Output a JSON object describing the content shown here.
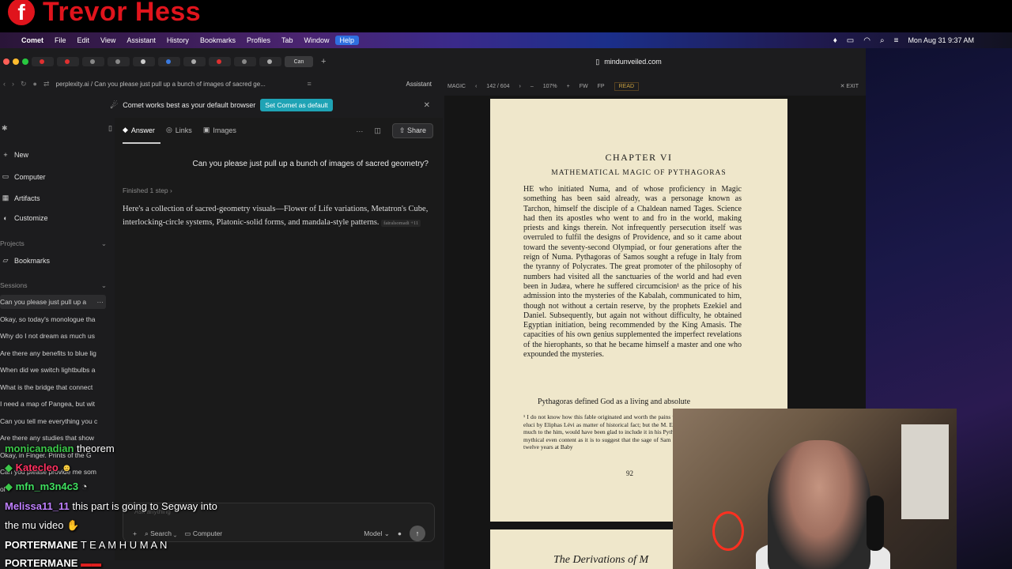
{
  "overlay": {
    "streamer_name": "Trevor Hess",
    "fb_glyph": "f"
  },
  "menubar": {
    "apple": "",
    "items": [
      "Comet",
      "File",
      "Edit",
      "View",
      "Assistant",
      "History",
      "Bookmarks",
      "Profiles",
      "Tab",
      "Window",
      "Help"
    ],
    "clock": "Mon Aug 31  9:37 AM"
  },
  "tabs": {
    "active_label": "Can",
    "plus": "+"
  },
  "urlbar": {
    "url": "perplexity.ai / Can you please just pull up a bunch of images of sacred ge...",
    "assistant": "Assistant"
  },
  "banner": {
    "message": "Comet works best as your default browser",
    "button": "Set Comet as default",
    "close": "✕"
  },
  "sidebar": {
    "new": "New",
    "computer": "Computer",
    "artifacts": "Artifacts",
    "customize": "Customize",
    "projects_label": "Projects",
    "bookmarks": "Bookmarks",
    "sessions_label": "Sessions",
    "sessions": [
      "Can you please just pull up a",
      "Okay, so today's monologue tha",
      "Why do I not dream as much us",
      "Are there any benefits to blue lig",
      "When did we switch lightbulbs a",
      "What is the bridge that connect",
      "I need a map of Pangea, but wit",
      "Can you tell me everything you c",
      "Are there any studies that show",
      "Okay, in Finger. Prints of the G",
      "Can you please provide me som",
      "ol"
    ]
  },
  "chat": {
    "tabs": [
      "Answer",
      "Links",
      "Images"
    ],
    "share": "Share",
    "query": "Can you please just pull up a bunch of images of sacred geometry?",
    "finished": "Finished 1 step  ›",
    "answer": "Here's a collection of sacred-geometry visuals—Flower of Life variations, Metatron's Cube, interlocking-circle systems, Platonic-solid forms, and mandala-style patterns.",
    "citation": "fairalsomadi +11",
    "input_placeholder": "Ask anything",
    "search": "Search",
    "computer": "Computer",
    "model": "Model",
    "send": "↑"
  },
  "reader": {
    "domain": "mindunveiled.com",
    "toolbar": [
      "MAGIC",
      "‹",
      "142 / 604",
      "›",
      "–",
      "107%",
      "+",
      "FW",
      "FP",
      "READ",
      "✕ EXIT"
    ],
    "chapter": "CHAPTER VI",
    "title": "MATHEMATICAL MAGIC OF PYTHAGORAS",
    "body": "HE who initiated Numa, and of whose proficiency in Magic something has been said already, was a personage known as Tarchon, himself the disciple of a Chaldean named Tages. Science had then its apostles who went to and fro in the world, making priests and kings therein. Not infrequently persecution itself was overruled to fulfil the designs of Providence, and so it came about toward the seventy-second Olympiad, or four generations after the reign of Numa. Pythagoras of Samos sought a refuge in Italy from the tyranny of Polycrates. The great promoter of the philosophy of numbers had visited all the sanctuaries of the world and had even been in Judæa, where he suffered circumcision¹ as the price of his admission into the mysteries of the Kabalah, communicated to him, though not without a certain reserve, by the prophets Ezekiel and Daniel. Subsequently, but again not without difficulty, he obtained Egyptian initiation, being recommended by the King Amasis. The capacities of his own genius supplemented the imperfect revelations of the hierophants, so that he became himself a master and one who expounded the mysteries.",
    "body2": "Pythagoras defined God as a living and absolute",
    "footnote": "¹ I do not know how this fable originated and worth the pains which would be necessary to eluci by Eliphas Lévi as matter of historical fact; but the M. Edouard Schuré, who owes so much to the him, would have been glad to include it in his Pythagoras, if it had not been too mythical even content as it is to suggest that the sage of Sam monotheism during a stay of twelve years at Baby",
    "page_number": "92",
    "next_title": "The Derivations of M"
  },
  "stream_chat": [
    {
      "user": "monicanadian",
      "msg": "theorem",
      "color": "#3cc84a"
    },
    {
      "user": "Katecleo",
      "msg": "",
      "color": "#ff3060"
    },
    {
      "user": "mfn_m3n4c3",
      "msg": "",
      "color": "#40e060"
    },
    {
      "user": "Melissa11_11",
      "msg": "this part is going to Segway into",
      "color": "#c080ff"
    },
    {
      "user": "",
      "msg": "the mu video",
      "color": "#ffffff"
    },
    {
      "user": "PORTERMANE",
      "msg": "T E A M H U M A N",
      "color": "#ffffff"
    },
    {
      "user": "PORTERMANE",
      "msg": "",
      "color": "#ffffff"
    }
  ]
}
